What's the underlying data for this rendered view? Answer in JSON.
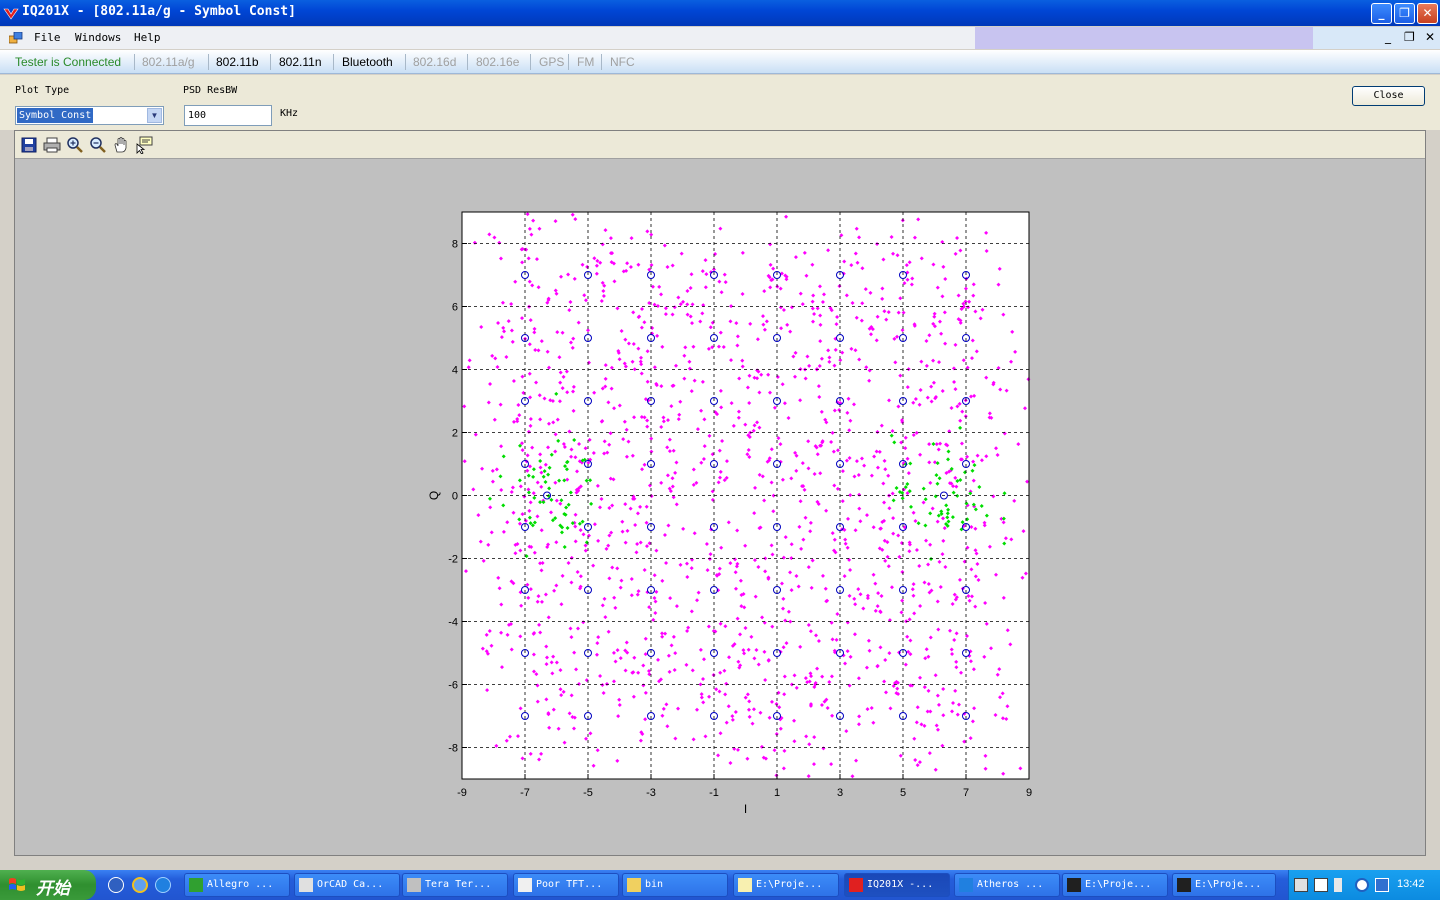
{
  "window": {
    "title": "IQ201X - [802.11a/g - Symbol Const]",
    "minimize_label": "_",
    "maximize_label": "❐",
    "close_label": "✕"
  },
  "menu": {
    "items": [
      "File",
      "Windows",
      "Help"
    ],
    "mdi_minimize": "_",
    "mdi_restore": "❐",
    "mdi_close": "✕"
  },
  "tabs": {
    "items": [
      {
        "label": "Tester is Connected",
        "state": "connected"
      },
      {
        "label": "802.11a/g",
        "state": "disabled"
      },
      {
        "label": "802.11b",
        "state": "enabled"
      },
      {
        "label": "802.11n",
        "state": "enabled"
      },
      {
        "label": "Bluetooth",
        "state": "enabled"
      },
      {
        "label": "802.16d",
        "state": "disabled"
      },
      {
        "label": "802.16e",
        "state": "disabled"
      },
      {
        "label": "GPS",
        "state": "disabled"
      },
      {
        "label": "FM",
        "state": "disabled"
      },
      {
        "label": "NFC",
        "state": "disabled"
      }
    ]
  },
  "controls": {
    "plot_type_label": "Plot Type",
    "plot_type_value": "Symbol Const",
    "resbw_label": "PSD ResBW",
    "resbw_value": "100",
    "resbw_unit": "KHz",
    "close_label": "Close"
  },
  "plot_toolbar": {
    "icons": [
      "save-icon",
      "print-icon",
      "zoom-in-icon",
      "zoom-out-icon",
      "pan-hand-icon",
      "data-cursor-icon"
    ]
  },
  "chart_data": {
    "type": "scatter",
    "title": "",
    "xlabel": "I",
    "ylabel": "Q",
    "xlim": [
      -9,
      9
    ],
    "ylim": [
      -9,
      9
    ],
    "xticks": [
      -9,
      -7,
      -5,
      -3,
      -1,
      1,
      3,
      5,
      7,
      9
    ],
    "yticks": [
      -8,
      -6,
      -4,
      -2,
      0,
      2,
      4,
      6,
      8
    ],
    "grid": true,
    "colors": {
      "data": "#ff00ff",
      "pilot": "#00dd00",
      "reference": "#0000c0"
    },
    "reference_points": {
      "i_levels": [
        -7,
        -5,
        -3,
        -1,
        1,
        3,
        5,
        7
      ],
      "q_levels": [
        -7,
        -5,
        -3,
        -1,
        1,
        3,
        5,
        7
      ],
      "extra": [
        [
          -6.3,
          0
        ],
        [
          6.3,
          0
        ]
      ]
    },
    "pilot_clusters": [
      [
        -6.3,
        0
      ],
      [
        6.3,
        0
      ]
    ],
    "points_approx_count": 1500
  },
  "taskbar": {
    "start_label": "开始",
    "tasks": [
      {
        "label": "Allegro ...",
        "icon": "allegro-icon",
        "active": false
      },
      {
        "label": "OrCAD Ca...",
        "icon": "orcad-icon",
        "active": false
      },
      {
        "label": "Tera Ter...",
        "icon": "teraterm-icon",
        "active": false
      },
      {
        "label": "Poor TFT...",
        "icon": "document-icon",
        "active": false
      },
      {
        "label": "bin",
        "icon": "folder-icon",
        "active": false
      },
      {
        "label": "E:\\Proje...",
        "icon": "notepad-icon",
        "active": false
      },
      {
        "label": "IQ201X -...",
        "icon": "iq-app-icon",
        "active": true
      },
      {
        "label": "Atheros ...",
        "icon": "atheros-icon",
        "active": false
      },
      {
        "label": "E:\\Proje...",
        "icon": "console-icon",
        "active": false
      },
      {
        "label": "E:\\Proje...",
        "icon": "console-icon",
        "active": false
      }
    ],
    "clock": "13:42"
  }
}
